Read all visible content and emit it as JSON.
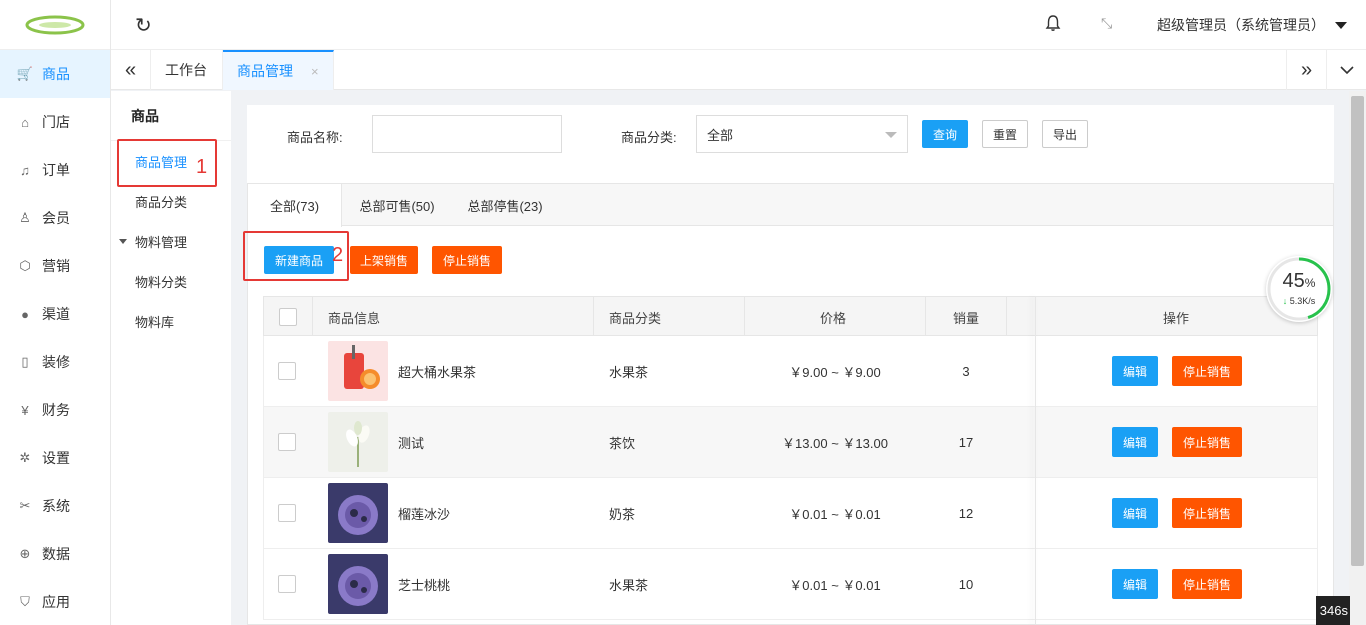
{
  "rail": {
    "items": [
      {
        "label": "商品",
        "icon": "cart-icon",
        "glyph": "🛒"
      },
      {
        "label": "门店",
        "icon": "home-icon",
        "glyph": "⌂"
      },
      {
        "label": "订单",
        "icon": "bell-icon",
        "glyph": "♫"
      },
      {
        "label": "会员",
        "icon": "user-icon",
        "glyph": "♙"
      },
      {
        "label": "营销",
        "icon": "box-icon",
        "glyph": "⬡"
      },
      {
        "label": "渠道",
        "icon": "link-icon",
        "glyph": "●"
      },
      {
        "label": "装修",
        "icon": "tablet-icon",
        "glyph": "▯"
      },
      {
        "label": "财务",
        "icon": "yen-icon",
        "glyph": "¥"
      },
      {
        "label": "设置",
        "icon": "gear-icon",
        "glyph": "✲"
      },
      {
        "label": "系统",
        "icon": "tools-icon",
        "glyph": "✂"
      },
      {
        "label": "数据",
        "icon": "globe-icon",
        "glyph": "⊕"
      },
      {
        "label": "应用",
        "icon": "shield-icon",
        "glyph": "⛉"
      }
    ]
  },
  "topbar": {
    "refresh_glyph": "↻",
    "fullscreen_glyph": "⤡",
    "user_name": "超级管理员（系统管理员）"
  },
  "tabs": {
    "left_arrow": "«",
    "right_arrow": "»",
    "items": [
      {
        "label": "工作台"
      },
      {
        "label": "商品管理",
        "close": "×"
      }
    ]
  },
  "subnav": {
    "title": "商品",
    "items": [
      {
        "label": "商品管理"
      },
      {
        "label": "商品分类"
      },
      {
        "label": "物料管理"
      },
      {
        "label": "物料分类"
      },
      {
        "label": "物料库"
      }
    ]
  },
  "filter": {
    "name_label": "商品名称:",
    "name_value": "",
    "category_label": "商品分类:",
    "category_value": "全部",
    "query": "查询",
    "reset": "重置",
    "export": "导出"
  },
  "status_tabs": [
    {
      "label": "全部(73)"
    },
    {
      "label": "总部可售(50)"
    },
    {
      "label": "总部停售(23)"
    }
  ],
  "actions": {
    "new": "新建商品",
    "on_sale": "上架销售",
    "stop_sale": "停止销售"
  },
  "table": {
    "headers": {
      "info": "商品信息",
      "category": "商品分类",
      "price": "价格",
      "sales": "销量",
      "ops": "操作"
    },
    "rows": [
      {
        "name": "超大桶水果茶",
        "category": "水果茶",
        "price": "￥9.00 ~ ￥9.00",
        "sales": "3"
      },
      {
        "name": "测试",
        "category": "茶饮",
        "price": "￥13.00 ~ ￥13.00",
        "sales": "17"
      },
      {
        "name": "榴莲冰沙",
        "category": "奶茶",
        "price": "￥0.01 ~ ￥0.01",
        "sales": "12"
      },
      {
        "name": "芝士桃桃",
        "category": "水果茶",
        "price": "￥0.01 ~ ￥0.01",
        "sales": "10"
      }
    ],
    "edit": "编辑",
    "stop": "停止销售"
  },
  "annotations": {
    "one": "1",
    "two": "2"
  },
  "speed": {
    "percent": "45",
    "unit": "%",
    "rate": "5.3K/s",
    "progress": 0.45
  },
  "timer": "346s",
  "colors": {
    "accent": "#1890ff",
    "blue_btn": "#1aa0f5",
    "orange_btn": "#ff5500",
    "annotation": "#e53935"
  }
}
